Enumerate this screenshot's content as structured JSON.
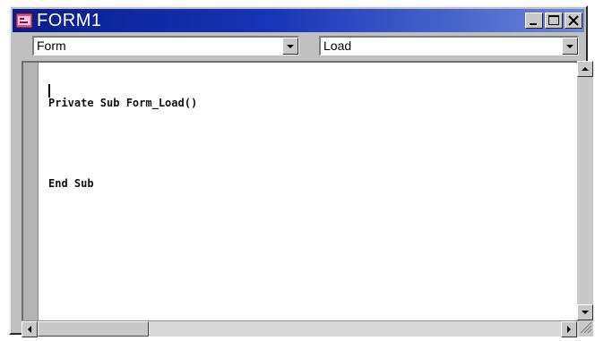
{
  "window": {
    "title": "FORM1",
    "title_colors": {
      "gradient_start": "#0a1d8a",
      "gradient_end": "#6d86d6",
      "text": "#ffffff"
    },
    "icons": {
      "app": "vb-form-icon",
      "minimize": "minimize-icon",
      "maximize": "maximize-icon",
      "close": "close-icon"
    }
  },
  "toolbar": {
    "object_combo": {
      "value": "Form"
    },
    "procedure_combo": {
      "value": "Load"
    }
  },
  "editor": {
    "lines": [
      "Private Sub Form_Load()",
      "",
      "End Sub"
    ]
  }
}
